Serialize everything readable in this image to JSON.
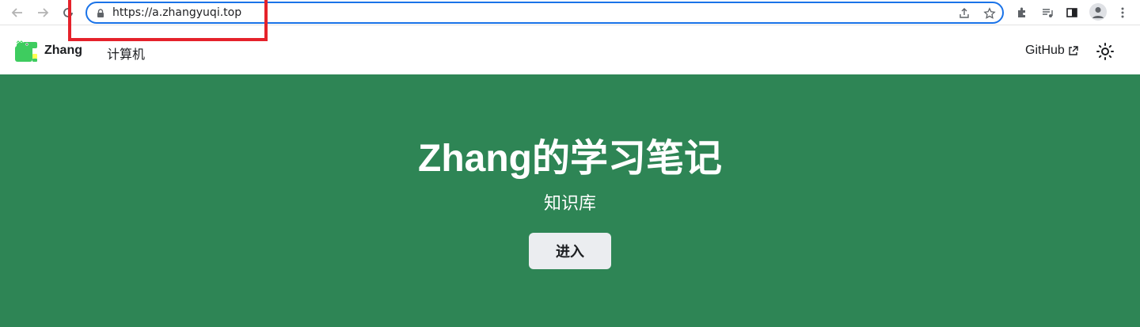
{
  "browser": {
    "url": "https://a.zhangyuqi.top",
    "icons": [
      "back-icon",
      "forward-icon",
      "reload-icon",
      "lock-icon",
      "share-icon",
      "star-icon",
      "extensions-icon",
      "media-icon",
      "side-panel-icon",
      "profile-icon",
      "menu-icon"
    ]
  },
  "navbar": {
    "brand": "Zhang",
    "links": [
      "计算机"
    ],
    "github": "GitHub"
  },
  "hero": {
    "title": "Zhang的学习笔记",
    "subtitle": "知识库",
    "button": "进入"
  },
  "colors": {
    "hero_bg": "#2e8555",
    "button_bg": "#ebedf0",
    "annotation": "#e5222b",
    "omnibox_border": "#1a73e8"
  }
}
